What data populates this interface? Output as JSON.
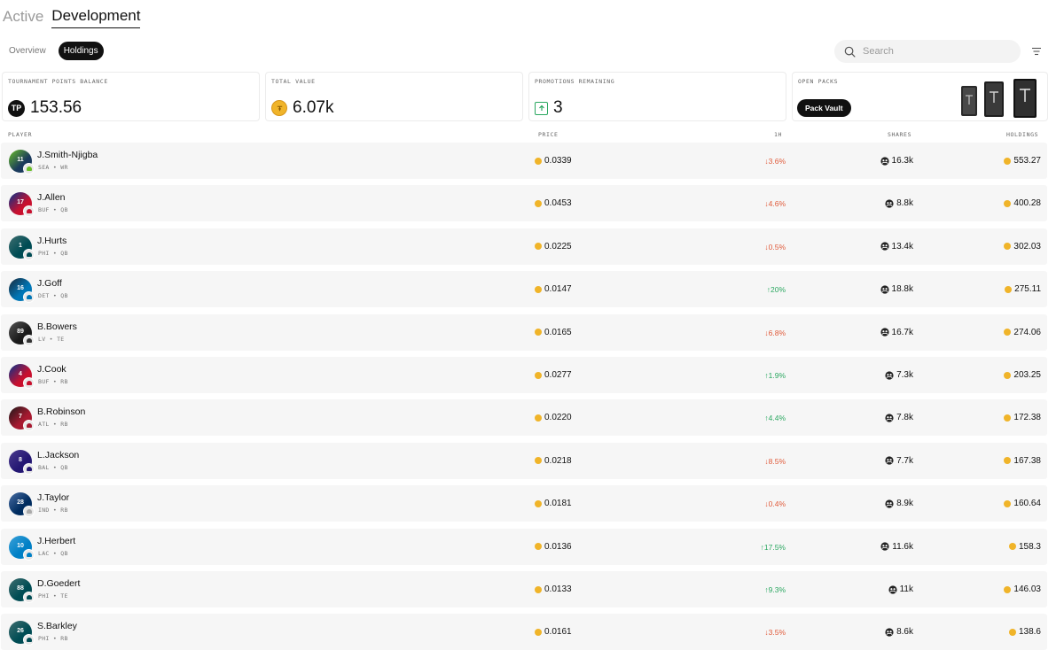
{
  "top_tabs": [
    {
      "label": "Active",
      "active": false
    },
    {
      "label": "Development",
      "active": true
    }
  ],
  "sub_tabs": [
    {
      "label": "Overview",
      "active": false
    },
    {
      "label": "Holdings",
      "active": true
    }
  ],
  "search": {
    "placeholder": "Search"
  },
  "cards": {
    "tp_balance": {
      "label": "TOURNAMENT POINTS BALANCE",
      "badge": "TP",
      "value": "153.56"
    },
    "total_value": {
      "label": "TOTAL VALUE",
      "value": "6.07k"
    },
    "promotions": {
      "label": "PROMOTIONS REMAINING",
      "value": "3"
    },
    "open_packs": {
      "label": "OPEN PACKS",
      "button": "Pack Vault"
    }
  },
  "columns": {
    "player": "PLAYER",
    "price": "PRICE",
    "change": "1H",
    "shares": "SHARES",
    "holdings": "HOLDINGS"
  },
  "colors": {
    "coin": "#f0b429",
    "up": "#2aa760",
    "down": "#e05a3a"
  },
  "rows": [
    {
      "name": "J.Smith-Njigba",
      "meta": "SEA • WR",
      "number": "11",
      "jersey": "#1a3a5c",
      "jersey2": "#69be28",
      "team": "#69be28",
      "price": "0.0339",
      "change": "↓3.6%",
      "dir": "down",
      "shares": "16.3k",
      "holdings": "553.27"
    },
    {
      "name": "J.Allen",
      "meta": "BUF • QB",
      "number": "17",
      "jersey": "#c8102e",
      "jersey2": "#00338d",
      "team": "#c8102e",
      "price": "0.0453",
      "change": "↓4.6%",
      "dir": "down",
      "shares": "8.8k",
      "holdings": "400.28"
    },
    {
      "name": "J.Hurts",
      "meta": "PHI • QB",
      "number": "1",
      "jersey": "#004c54",
      "jersey2": "#3f6e70",
      "team": "#004c54",
      "price": "0.0225",
      "change": "↓0.5%",
      "dir": "down",
      "shares": "13.4k",
      "holdings": "302.03"
    },
    {
      "name": "J.Goff",
      "meta": "DET • QB",
      "number": "16",
      "jersey": "#0076b6",
      "jersey2": "#1b2a3a",
      "team": "#0076b6",
      "price": "0.0147",
      "change": "↑20%",
      "dir": "up",
      "shares": "18.8k",
      "holdings": "275.11"
    },
    {
      "name": "B.Bowers",
      "meta": "LV • TE",
      "number": "89",
      "jersey": "#1a1a1a",
      "jersey2": "#555555",
      "team": "#333333",
      "price": "0.0165",
      "change": "↓6.8%",
      "dir": "down",
      "shares": "16.7k",
      "holdings": "274.06"
    },
    {
      "name": "J.Cook",
      "meta": "BUF • RB",
      "number": "4",
      "jersey": "#c8102e",
      "jersey2": "#00338d",
      "team": "#c8102e",
      "price": "0.0277",
      "change": "↑1.9%",
      "dir": "up",
      "shares": "7.3k",
      "holdings": "203.25"
    },
    {
      "name": "B.Robinson",
      "meta": "ATL • RB",
      "number": "7",
      "jersey": "#a71930",
      "jersey2": "#1a1a1a",
      "team": "#a71930",
      "price": "0.0220",
      "change": "↑4.4%",
      "dir": "up",
      "shares": "7.8k",
      "holdings": "172.38"
    },
    {
      "name": "L.Jackson",
      "meta": "BAL • QB",
      "number": "8",
      "jersey": "#241773",
      "jersey2": "#4b3c8e",
      "team": "#241773",
      "price": "0.0218",
      "change": "↓8.5%",
      "dir": "down",
      "shares": "7.7k",
      "holdings": "167.38"
    },
    {
      "name": "J.Taylor",
      "meta": "IND • RB",
      "number": "28",
      "jersey": "#002c5f",
      "jersey2": "#4a6fa5",
      "team": "#aaaaaa",
      "price": "0.0181",
      "change": "↓0.4%",
      "dir": "down",
      "shares": "8.9k",
      "holdings": "160.64"
    },
    {
      "name": "J.Herbert",
      "meta": "LAC • QB",
      "number": "10",
      "jersey": "#0080c6",
      "jersey2": "#3aa0d8",
      "team": "#0080c6",
      "price": "0.0136",
      "change": "↑17.5%",
      "dir": "up",
      "shares": "11.6k",
      "holdings": "158.3"
    },
    {
      "name": "D.Goedert",
      "meta": "PHI • TE",
      "number": "88",
      "jersey": "#004c54",
      "jersey2": "#3f6e70",
      "team": "#004c54",
      "price": "0.0133",
      "change": "↑9.3%",
      "dir": "up",
      "shares": "11k",
      "holdings": "146.03"
    },
    {
      "name": "S.Barkley",
      "meta": "PHI • RB",
      "number": "26",
      "jersey": "#004c54",
      "jersey2": "#3f6e70",
      "team": "#004c54",
      "price": "0.0161",
      "change": "↓3.5%",
      "dir": "down",
      "shares": "8.6k",
      "holdings": "138.6"
    }
  ]
}
